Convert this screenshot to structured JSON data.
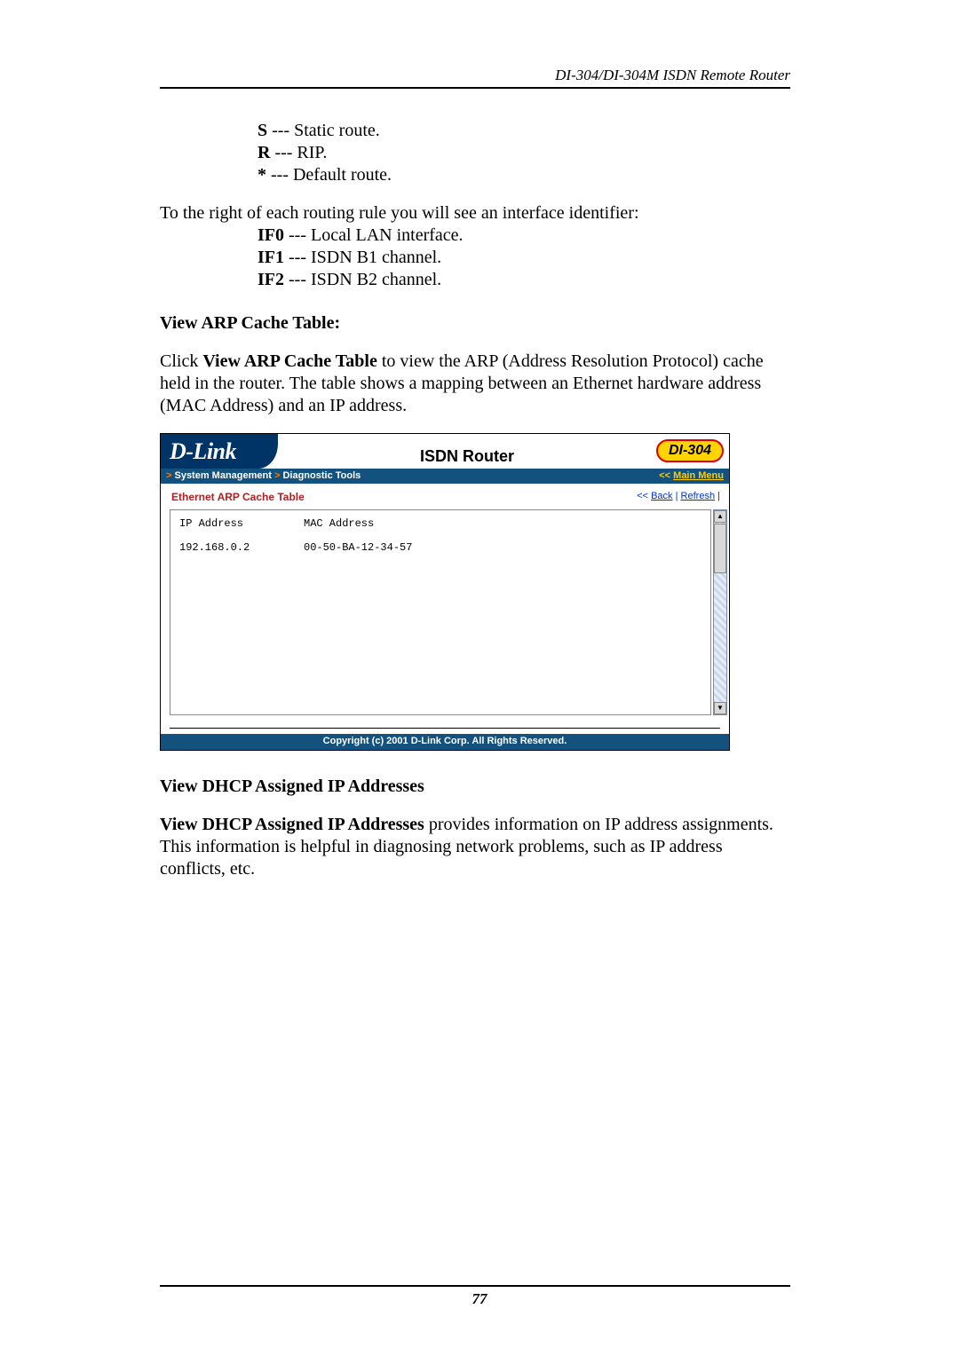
{
  "header": {
    "right": "DI-304/DI-304M ISDN Remote Router"
  },
  "legend": {
    "s_key": "S",
    "s_text": " --- Static route.",
    "r_key": "R",
    "r_text": " --- RIP.",
    "star_key": "*",
    "star_text": " --- Default route."
  },
  "intro_if": "To the right of each routing rule you will see an interface identifier:",
  "iface": {
    "if0_key": "IF0",
    "if0_text": " --- Local LAN interface.",
    "if1_key": "IF1",
    "if1_text": " --- ISDN B1 channel.",
    "if2_key": "IF2",
    "if2_text": " --- ISDN B2 channel."
  },
  "arp": {
    "heading": "View ARP Cache Table:",
    "p_prefix": "Click ",
    "p_bold": "View ARP Cache Table",
    "p_suffix": " to view the ARP (Address Resolution Protocol) cache held in the router. The table shows a mapping between an Ethernet hardware address (MAC Address) and an IP address."
  },
  "router": {
    "logo": "D-Link",
    "title": "ISDN Router",
    "badge": "DI-304",
    "bc_left_1": "System Management",
    "bc_left_2": "Diagnostic Tools",
    "bc_right_prefix": "<< ",
    "bc_right_link": "Main Menu",
    "section_title": "Ethernet ARP Cache Table",
    "link_back_prefix": "<< ",
    "link_back": "Back",
    "link_sep": " | ",
    "link_refresh": "Refresh",
    "link_trail": " |",
    "table": {
      "col1_header": "IP Address",
      "col2_header": "MAC Address",
      "rows": [
        {
          "ip": "192.168.0.2",
          "mac": "00-50-BA-12-34-57"
        }
      ]
    },
    "copyright": "Copyright (c) 2001 D-Link Corp. All Rights Reserved."
  },
  "dhcp": {
    "heading": "View DHCP Assigned IP Addresses",
    "p_bold": "View DHCP Assigned IP Addresses",
    "p_suffix": " provides information on IP address assignments. This information is helpful in diagnosing network problems, such as IP address conflicts, etc."
  },
  "page_number": "77"
}
